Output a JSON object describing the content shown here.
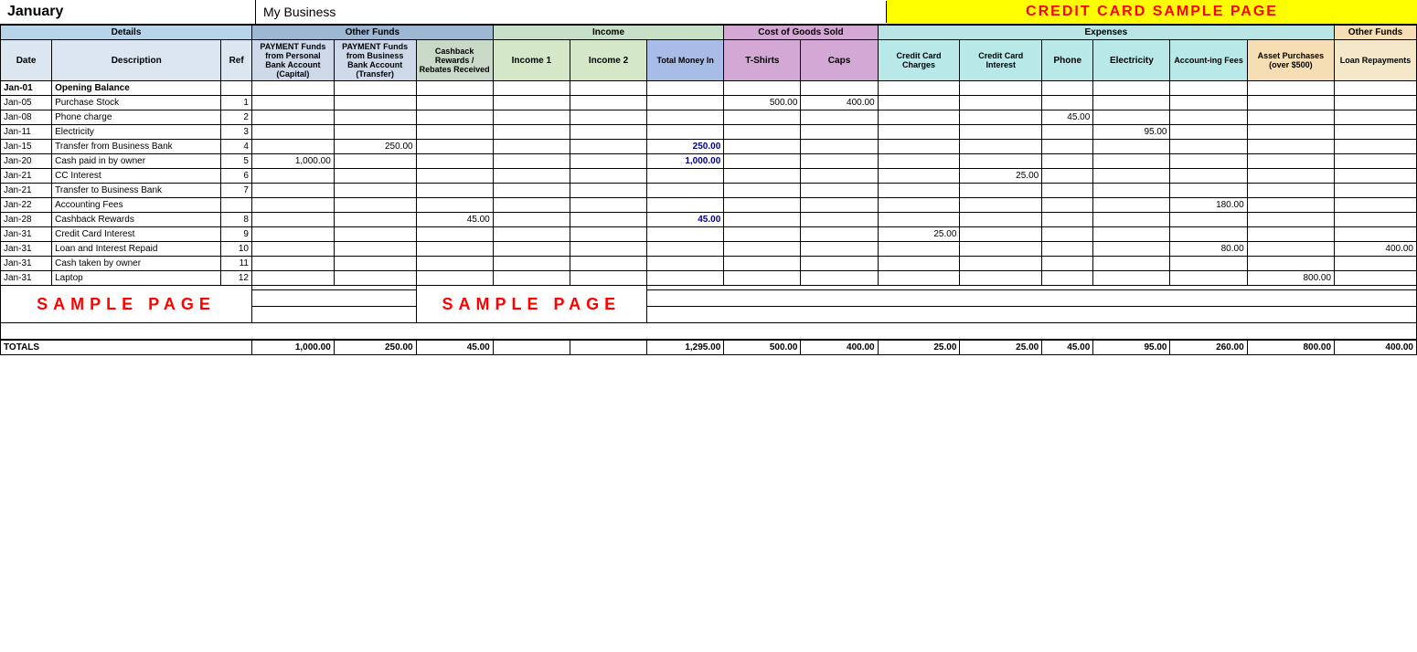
{
  "topBar": {
    "month": "January",
    "business": "My Business",
    "pageTitle": "CREDIT CARD SAMPLE PAGE"
  },
  "headers": {
    "section1": "Details",
    "section2": "Other Funds",
    "section3": "Income",
    "section4": "Cost of Goods Sold",
    "section5": "Expenses",
    "section6": "Other Funds"
  },
  "columnHeaders": {
    "date": "Date",
    "description": "Description",
    "ref": "Ref",
    "paymentPersonal": "PAYMENT Funds from Personal Bank Account (Capital)",
    "paymentBusiness": "PAYMENT Funds from Business Bank Account (Transfer)",
    "cashback": "Cashback Rewards / Rebates Received",
    "income1": "Income 1",
    "income2": "Income 2",
    "totalMoney": "Total Money In",
    "tshirts": "T-Shirts",
    "caps": "Caps",
    "ccCharges": "Credit Card Charges",
    "ccInterest": "Credit Card Interest",
    "phone": "Phone",
    "electricity": "Electricity",
    "accountingFees": "Account-ing Fees",
    "assetPurchases": "Asset Purchases (over $500)",
    "loanRepayments": "Loan Repayments"
  },
  "rows": [
    {
      "date": "Jan-01",
      "desc": "Opening Balance",
      "ref": "",
      "payPersonal": "",
      "payBusiness": "",
      "cashback": "",
      "inc1": "",
      "inc2": "",
      "total": "",
      "tshirts": "",
      "caps": "",
      "ccCharges": "",
      "ccInterest": "",
      "phone": "",
      "electricity": "",
      "accounting": "",
      "asset": "",
      "loan": "",
      "isOpeningBalance": true
    },
    {
      "date": "Jan-05",
      "desc": "Purchase Stock",
      "ref": "1",
      "payPersonal": "",
      "payBusiness": "",
      "cashback": "",
      "inc1": "",
      "inc2": "",
      "total": "",
      "tshirts": "500.00",
      "caps": "400.00",
      "ccCharges": "",
      "ccInterest": "",
      "phone": "",
      "electricity": "",
      "accounting": "",
      "asset": "",
      "loan": ""
    },
    {
      "date": "Jan-08",
      "desc": "Phone charge",
      "ref": "2",
      "payPersonal": "",
      "payBusiness": "",
      "cashback": "",
      "inc1": "",
      "inc2": "",
      "total": "",
      "tshirts": "",
      "caps": "",
      "ccCharges": "",
      "ccInterest": "",
      "phone": "45.00",
      "electricity": "",
      "accounting": "",
      "asset": "",
      "loan": ""
    },
    {
      "date": "Jan-11",
      "desc": "Electricity",
      "ref": "3",
      "payPersonal": "",
      "payBusiness": "",
      "cashback": "",
      "inc1": "",
      "inc2": "",
      "total": "",
      "tshirts": "",
      "caps": "",
      "ccCharges": "",
      "ccInterest": "",
      "phone": "",
      "electricity": "95.00",
      "accounting": "",
      "asset": "",
      "loan": ""
    },
    {
      "date": "Jan-15",
      "desc": "Transfer from Business Bank",
      "ref": "4",
      "payPersonal": "",
      "payBusiness": "250.00",
      "cashback": "",
      "inc1": "",
      "inc2": "",
      "total": "250.00",
      "tshirts": "",
      "caps": "",
      "ccCharges": "",
      "ccInterest": "",
      "phone": "",
      "electricity": "",
      "accounting": "",
      "asset": "",
      "loan": ""
    },
    {
      "date": "Jan-20",
      "desc": "Cash paid in by owner",
      "ref": "5",
      "payPersonal": "1,000.00",
      "payBusiness": "",
      "cashback": "",
      "inc1": "",
      "inc2": "",
      "total": "1,000.00",
      "tshirts": "",
      "caps": "",
      "ccCharges": "",
      "ccInterest": "",
      "phone": "",
      "electricity": "",
      "accounting": "",
      "asset": "",
      "loan": ""
    },
    {
      "date": "Jan-21",
      "desc": "CC Interest",
      "ref": "6",
      "payPersonal": "",
      "payBusiness": "",
      "cashback": "",
      "inc1": "",
      "inc2": "",
      "total": "",
      "tshirts": "",
      "caps": "",
      "ccCharges": "",
      "ccInterest": "25.00",
      "phone": "",
      "electricity": "",
      "accounting": "",
      "asset": "",
      "loan": ""
    },
    {
      "date": "Jan-21",
      "desc": "Transfer to Business Bank",
      "ref": "7",
      "payPersonal": "",
      "payBusiness": "",
      "cashback": "",
      "inc1": "",
      "inc2": "",
      "total": "",
      "tshirts": "",
      "caps": "",
      "ccCharges": "",
      "ccInterest": "",
      "phone": "",
      "electricity": "",
      "accounting": "",
      "asset": "",
      "loan": ""
    },
    {
      "date": "Jan-22",
      "desc": "Accounting Fees",
      "ref": "",
      "payPersonal": "",
      "payBusiness": "",
      "cashback": "",
      "inc1": "",
      "inc2": "",
      "total": "",
      "tshirts": "",
      "caps": "",
      "ccCharges": "",
      "ccInterest": "",
      "phone": "",
      "electricity": "",
      "accounting": "180.00",
      "asset": "",
      "loan": ""
    },
    {
      "date": "Jan-28",
      "desc": "Cashback Rewards",
      "ref": "8",
      "payPersonal": "",
      "payBusiness": "",
      "cashback": "45.00",
      "inc1": "",
      "inc2": "",
      "total": "45.00",
      "tshirts": "",
      "caps": "",
      "ccCharges": "",
      "ccInterest": "",
      "phone": "",
      "electricity": "",
      "accounting": "",
      "asset": "",
      "loan": ""
    },
    {
      "date": "Jan-31",
      "desc": "Credit Card Interest",
      "ref": "9",
      "payPersonal": "",
      "payBusiness": "",
      "cashback": "",
      "inc1": "",
      "inc2": "",
      "total": "",
      "tshirts": "",
      "caps": "",
      "ccCharges": "25.00",
      "ccInterest": "",
      "phone": "",
      "electricity": "",
      "accounting": "",
      "asset": "",
      "loan": ""
    },
    {
      "date": "Jan-31",
      "desc": "Loan and Interest Repaid",
      "ref": "10",
      "payPersonal": "",
      "payBusiness": "",
      "cashback": "",
      "inc1": "",
      "inc2": "",
      "total": "",
      "tshirts": "",
      "caps": "",
      "ccCharges": "",
      "ccInterest": "",
      "phone": "",
      "electricity": "",
      "accounting": "80.00",
      "asset": "",
      "loan": "400.00"
    },
    {
      "date": "Jan-31",
      "desc": "Cash taken by owner",
      "ref": "11",
      "payPersonal": "",
      "payBusiness": "",
      "cashback": "",
      "inc1": "",
      "inc2": "",
      "total": "",
      "tshirts": "",
      "caps": "",
      "ccCharges": "",
      "ccInterest": "",
      "phone": "",
      "electricity": "",
      "accounting": "",
      "asset": "",
      "loan": ""
    },
    {
      "date": "Jan-31",
      "desc": "Laptop",
      "ref": "12",
      "payPersonal": "",
      "payBusiness": "",
      "cashback": "",
      "inc1": "",
      "inc2": "",
      "total": "",
      "tshirts": "",
      "caps": "",
      "ccCharges": "",
      "ccInterest": "",
      "phone": "",
      "electricity": "",
      "accounting": "",
      "asset": "800.00",
      "loan": ""
    }
  ],
  "emptyRows": [
    "",
    "",
    ""
  ],
  "samplePageLeft": "SAMPLE PAGE",
  "samplePageCenter": "SAMPLE PAGE",
  "totals": {
    "label": "TOTALS",
    "payPersonal": "1,000.00",
    "payBusiness": "250.00",
    "cashback": "45.00",
    "inc1": "",
    "inc2": "",
    "total": "1,295.00",
    "tshirts": "500.00",
    "caps": "400.00",
    "ccCharges": "25.00",
    "ccInterest": "25.00",
    "phone": "45.00",
    "electricity": "95.00",
    "accounting": "260.00",
    "asset": "800.00",
    "loan": "400.00"
  }
}
